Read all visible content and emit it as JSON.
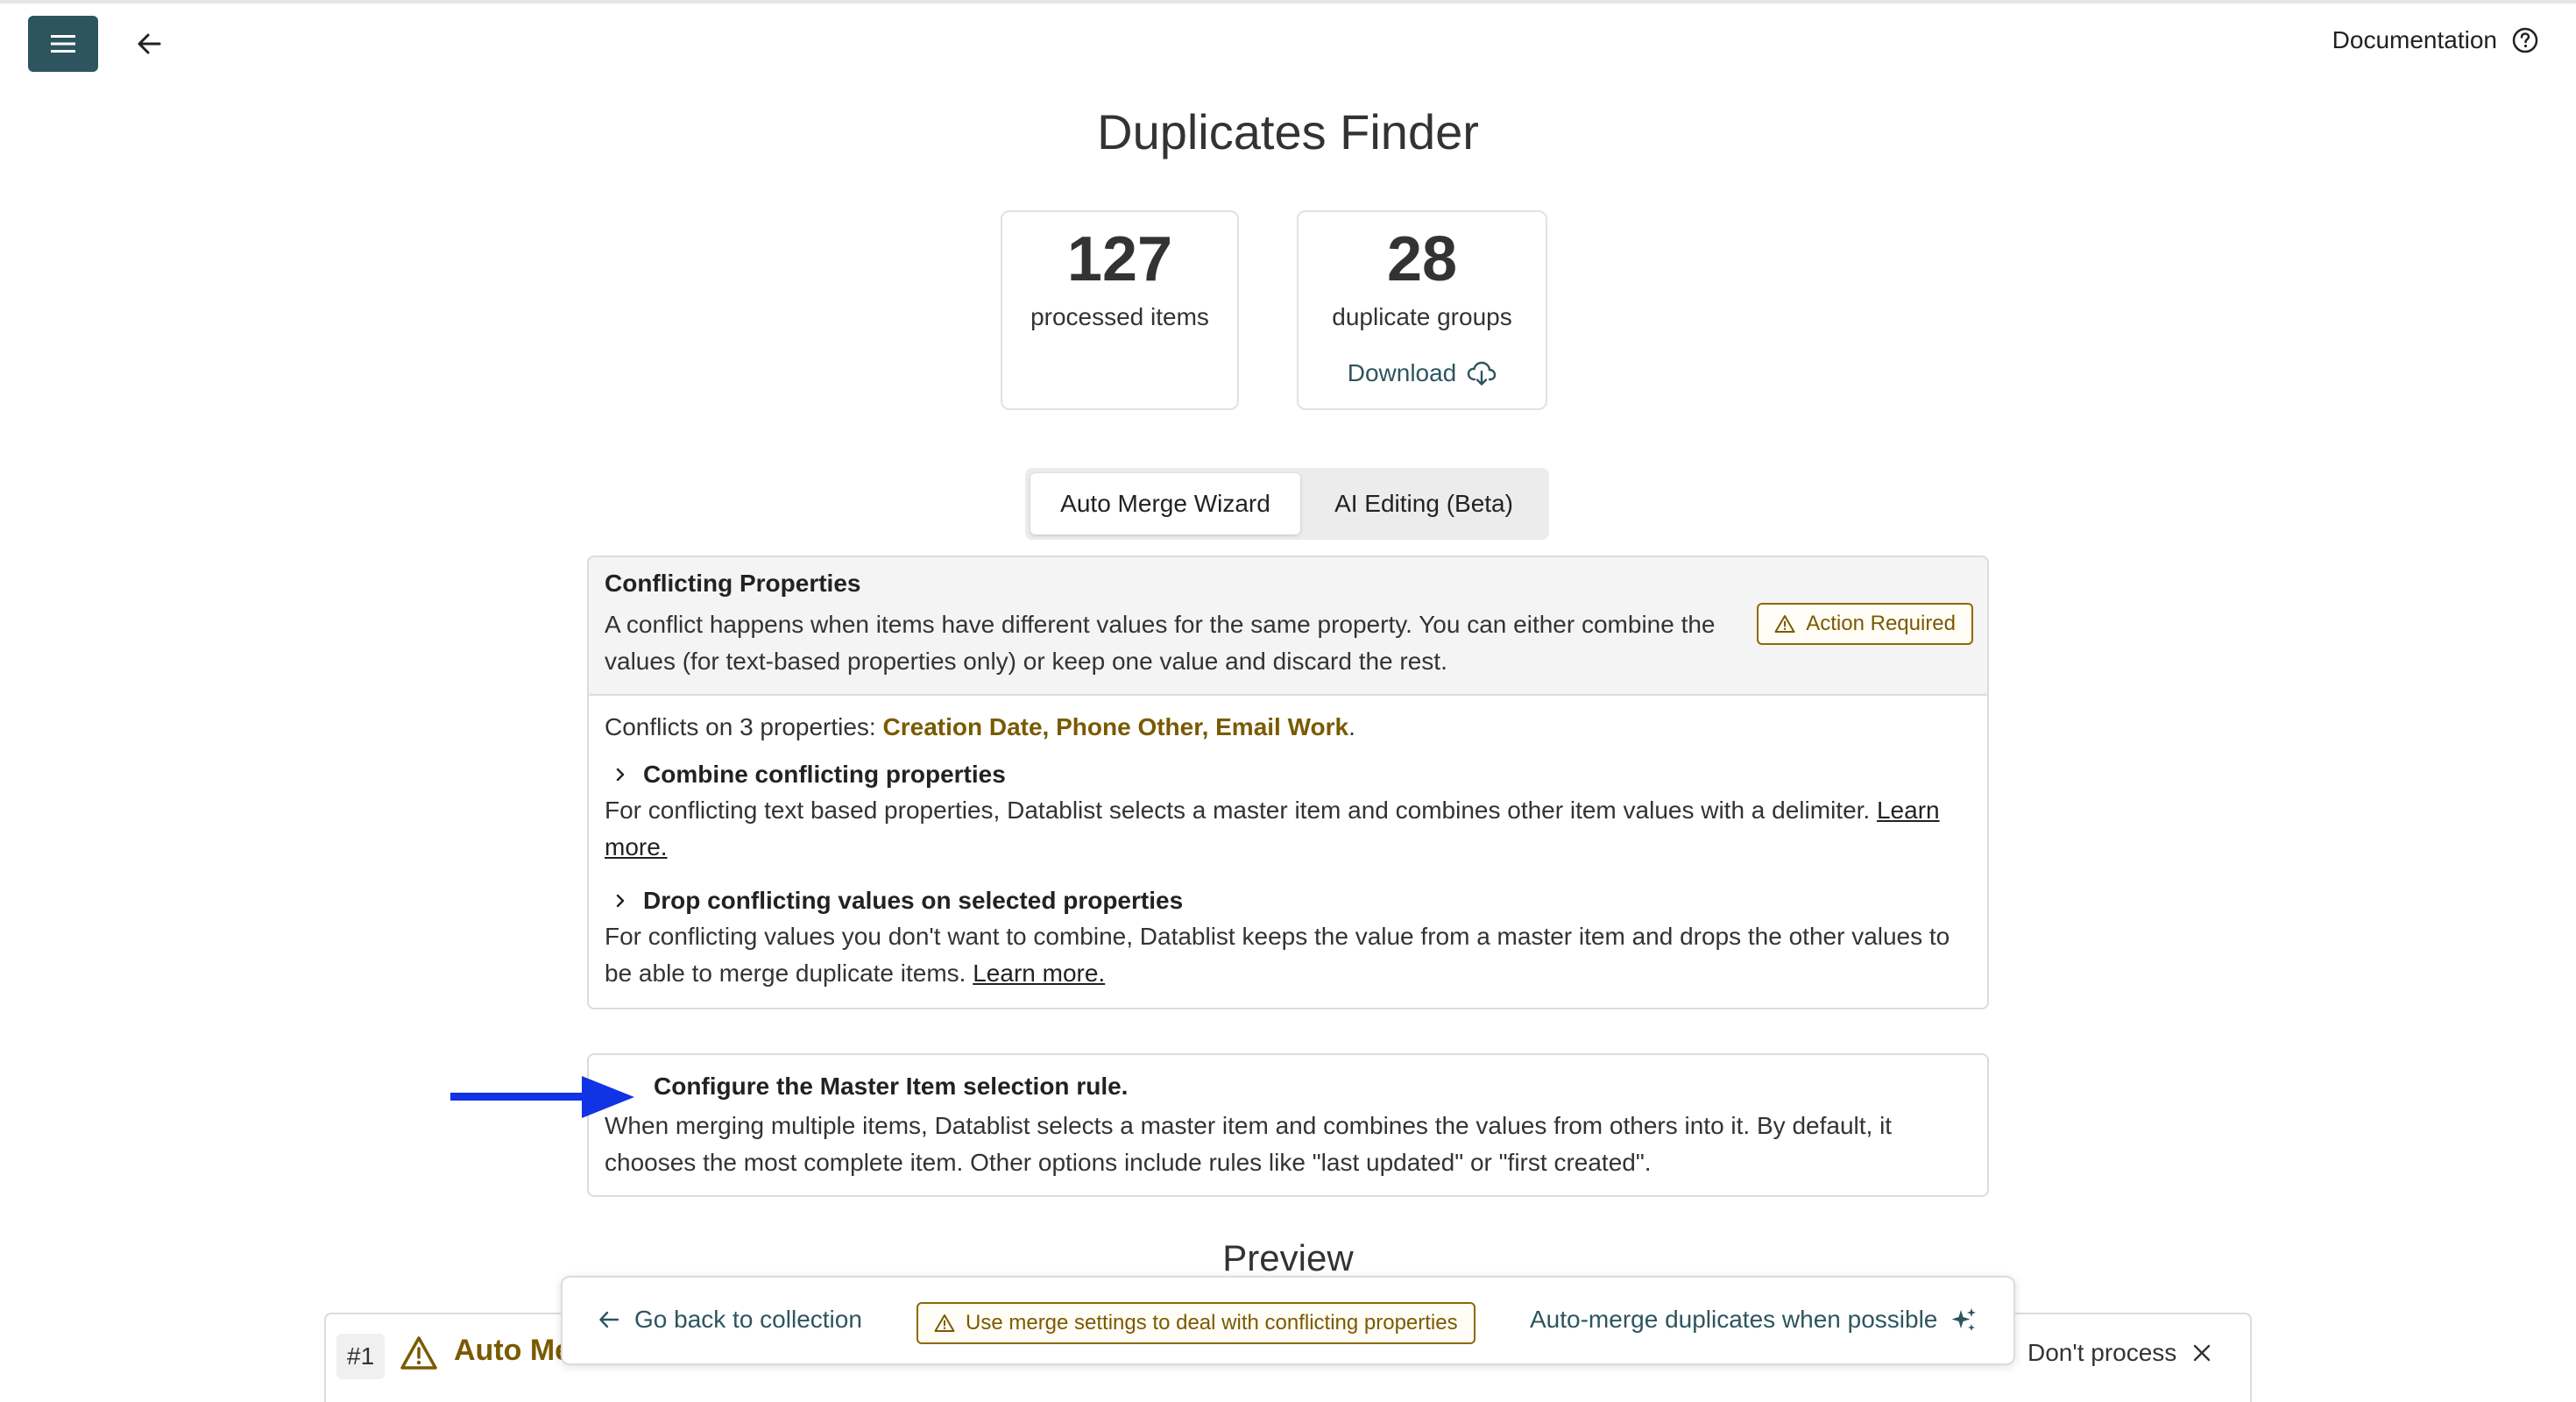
{
  "header": {
    "docs_label": "Documentation",
    "menu_icon": "hamburger-icon",
    "back_icon": "arrow-left-icon",
    "help_icon": "help-circle-icon"
  },
  "page": {
    "title": "Duplicates Finder"
  },
  "stats": {
    "processed_count": "127",
    "processed_label": "processed items",
    "groups_count": "28",
    "groups_label": "duplicate groups",
    "download_label": "Download"
  },
  "tabs": [
    {
      "label": "Auto Merge Wizard",
      "active": true
    },
    {
      "label": "AI Editing (Beta)",
      "active": false
    }
  ],
  "conflicts": {
    "title": "Conflicting Properties",
    "description": "A conflict happens when items have different values for the same property. You can either combine the values (for text-based properties only) or keep one value and discard the rest.",
    "badge": "Action Required",
    "summary_prefix": "Conflicts on 3 properties: ",
    "summary_props": "Creation Date, Phone Other, Email Work",
    "summary_suffix": ".",
    "combine": {
      "title": "Combine conflicting properties",
      "description": "For conflicting text based properties, Datablist selects a master item and combines other item values with a delimiter. ",
      "link": "Learn more."
    },
    "drop": {
      "title": "Drop conflicting values on selected properties",
      "description": "For conflicting values you don't want to combine, Datablist keeps the value from a master item and drops the other values to be able to merge duplicate items. ",
      "link": "Learn more."
    }
  },
  "master": {
    "title": "Configure the Master Item selection rule.",
    "description": "When merging multiple items, Datablist selects a master item and combines the values from others into it. By default, it chooses the most complete item. Other options include rules like \"last updated\" or \"first created\"."
  },
  "preview": {
    "title": "Preview",
    "row_number": "#1",
    "row_label": "Auto Me",
    "dont_process": "Don't process"
  },
  "action_bar": {
    "go_back": "Go back to collection",
    "merge_settings": "Use merge settings to deal with conflicting properties",
    "auto_merge": "Auto-merge duplicates when possible"
  },
  "colors": {
    "accent": "#2d5560",
    "warning": "#7a5a00",
    "annotation_arrow": "#1033e6"
  }
}
